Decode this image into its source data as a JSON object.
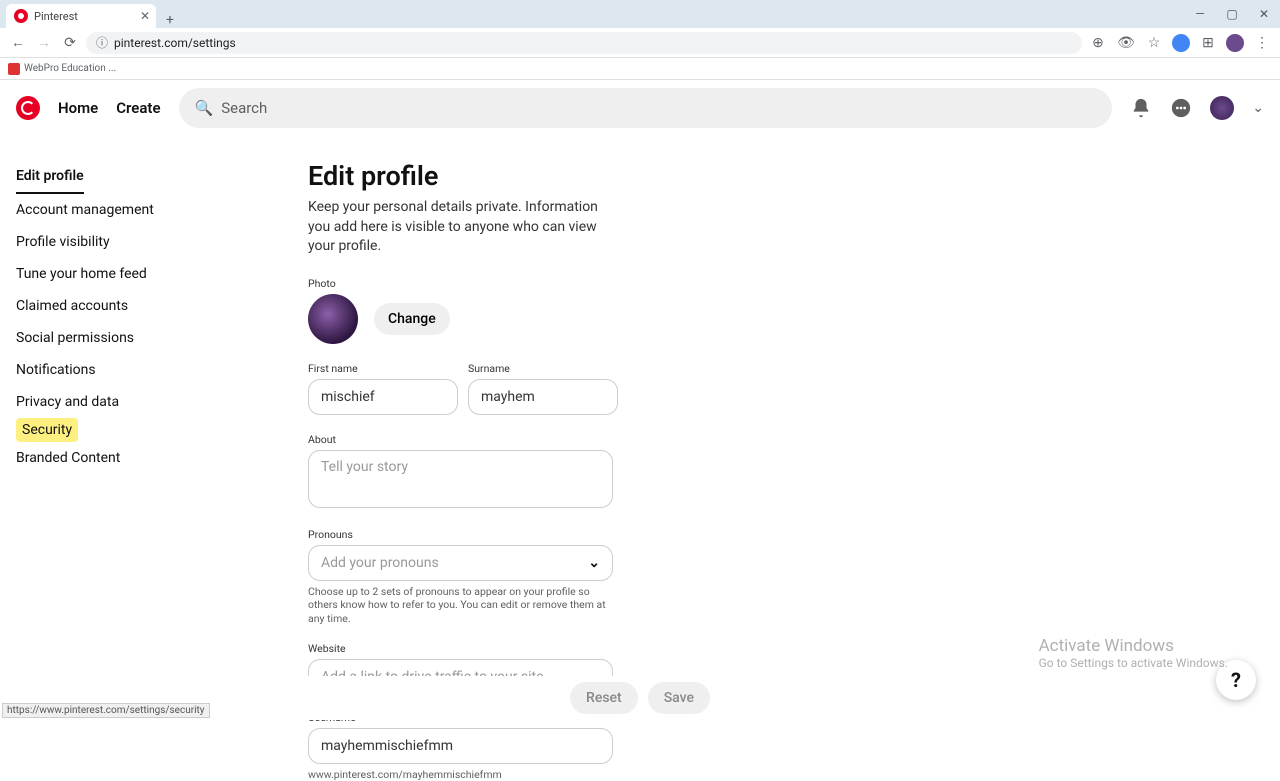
{
  "browser": {
    "tab_title": "Pinterest",
    "url": "pinterest.com/settings",
    "bookmark": "WebPro Education ...",
    "status_link": "https://www.pinterest.com/settings/security"
  },
  "header": {
    "home": "Home",
    "create": "Create",
    "search_placeholder": "Search"
  },
  "sidebar": {
    "items": [
      "Edit profile",
      "Account management",
      "Profile visibility",
      "Tune your home feed",
      "Claimed accounts",
      "Social permissions",
      "Notifications",
      "Privacy and data",
      "Security",
      "Branded Content"
    ]
  },
  "page": {
    "title": "Edit profile",
    "description": "Keep your personal details private. Information you add here is visible to anyone who can view your profile.",
    "photo_label": "Photo",
    "change_button": "Change",
    "first_name_label": "First name",
    "first_name_value": "mischief",
    "surname_label": "Surname",
    "surname_value": "mayhem",
    "about_label": "About",
    "about_placeholder": "Tell your story",
    "pronouns_label": "Pronouns",
    "pronouns_placeholder": "Add your pronouns",
    "pronouns_helper": "Choose up to 2 sets of pronouns to appear on your profile so others know how to refer to you. You can edit or remove them at any time.",
    "website_label": "Website",
    "website_placeholder": "Add a link to drive traffic to your site",
    "username_label": "Username",
    "username_value": "mayhemmischiefmm",
    "username_url": "www.pinterest.com/mayhemmischiefmm",
    "reset_button": "Reset",
    "save_button": "Save"
  },
  "watermark": {
    "title": "Activate Windows",
    "subtitle": "Go to Settings to activate Windows."
  }
}
